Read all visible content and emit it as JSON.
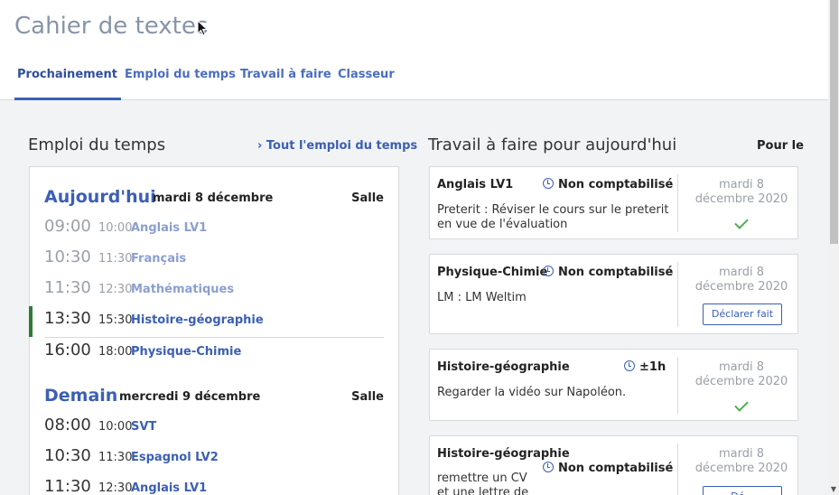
{
  "app": {
    "title": "Cahier de textes"
  },
  "tabs": [
    {
      "label": "Prochainement",
      "active": true
    },
    {
      "label": "Emploi du temps",
      "active": false
    },
    {
      "label": "Travail à faire",
      "active": false
    },
    {
      "label": "Classeur",
      "active": false
    }
  ],
  "schedule": {
    "section_title": "Emploi du temps",
    "link_label": "› Tout l'emploi du temps",
    "days": [
      {
        "name": "Aujourd'hui",
        "date": "mardi 8 décembre",
        "salle_label": "Salle",
        "slots": [
          {
            "start": "09:00",
            "end": "10:00",
            "subject": "Anglais LV1",
            "state": "past"
          },
          {
            "start": "10:30",
            "end": "11:30",
            "subject": "Français",
            "state": "past"
          },
          {
            "start": "11:30",
            "end": "12:30",
            "subject": "Mathématiques",
            "state": "past"
          },
          {
            "start": "13:30",
            "end": "15:30",
            "subject": "Histoire-géographie",
            "state": "current"
          },
          {
            "start": "16:00",
            "end": "18:00",
            "subject": "Physique-Chimie",
            "state": "upcoming"
          }
        ]
      },
      {
        "name": "Demain",
        "date": "mercredi 9 décembre",
        "salle_label": "Salle",
        "slots": [
          {
            "start": "08:00",
            "end": "10:00",
            "subject": "SVT",
            "state": "upcoming"
          },
          {
            "start": "10:30",
            "end": "11:30",
            "subject": "Espagnol LV2",
            "state": "upcoming"
          },
          {
            "start": "11:30",
            "end": "12:30",
            "subject": "Anglais LV1",
            "state": "upcoming"
          }
        ]
      }
    ]
  },
  "homework": {
    "section_title": "Travail à faire pour aujourd'hui",
    "pour_le_label": "Pour le",
    "items": [
      {
        "subject": "Anglais LV1",
        "status": "Non comptabilisé",
        "description": "Preterit : Réviser le cours sur le preterit en vue de l'évaluation",
        "due_line1": "mardi 8",
        "due_line2": "décembre 2020",
        "done": true,
        "button": ""
      },
      {
        "subject": "Physique-Chimie",
        "status": "Non comptabilisé",
        "description": "LM : LM Weltim",
        "due_line1": "mardi 8",
        "due_line2": "décembre 2020",
        "done": false,
        "button": "Déclarer fait"
      },
      {
        "subject": "Histoire-géographie",
        "status": "±1h",
        "description": "Regarder la vidéo sur Napoléon.",
        "due_line1": "mardi 8",
        "due_line2": "décembre 2020",
        "done": true,
        "button": ""
      },
      {
        "subject": "Histoire-géographie",
        "status": "Non comptabilisé",
        "description": "remettre un CV et une lettre de motivation",
        "due_line1": "mardi 8",
        "due_line2": "décembre 2020",
        "done": false,
        "button": "Dé..."
      }
    ]
  },
  "colors": {
    "accent": "#3b5fb4",
    "current_marker": "#2e7d32",
    "done_check": "#4caf50",
    "title_grey": "#8794a8"
  }
}
